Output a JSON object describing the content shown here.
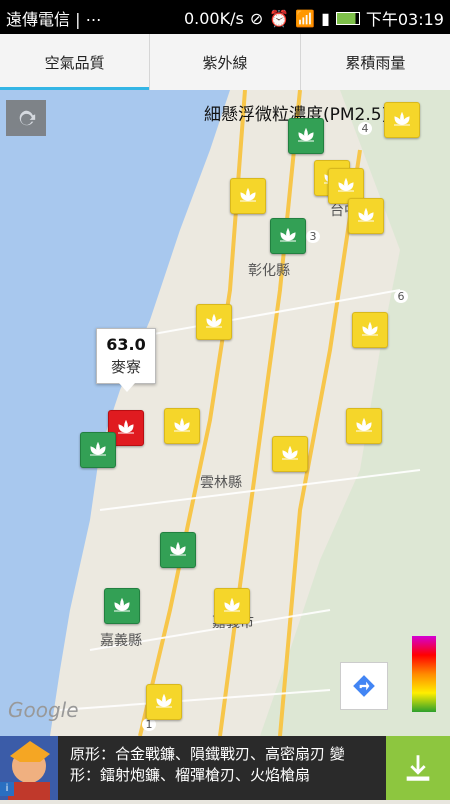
{
  "status": {
    "carrier": "遠傳電信 | ⋯",
    "speed": "0.00K/s",
    "time": "下午03:19"
  },
  "tabs": [
    {
      "label": "空氣品質",
      "active": true
    },
    {
      "label": "紫外線",
      "active": false
    },
    {
      "label": "累積雨量",
      "active": false
    }
  ],
  "map": {
    "title": "細懸浮微粒濃度(PM2.5)",
    "selected": {
      "value": "63.0",
      "name": "麥寮"
    },
    "labels": [
      "台中市",
      "彰化縣",
      "雲林縣",
      "嘉義縣",
      "嘉義市"
    ],
    "road_numbers": [
      "4",
      "3",
      "6",
      "1"
    ],
    "attribution": "Google",
    "colors": {
      "yellow": "#f5d62a",
      "green": "#33a055",
      "red": "#e01b20",
      "accent": "#33b5e5"
    },
    "marker_colors": [
      "green",
      "yellow",
      "yellow",
      "yellow",
      "yellow",
      "green",
      "yellow",
      "yellow",
      "red",
      "yellow",
      "green",
      "yellow",
      "yellow",
      "green",
      "green",
      "yellow",
      "yellow",
      "yellow"
    ]
  },
  "ad": {
    "line1": "原形：合金戰鐮、隕鐵戰刃、高密扇刃 變",
    "line2": "形：鐳射炮鐮、榴彈槍刃、火焰槍扇",
    "download_icon": "download-icon"
  }
}
